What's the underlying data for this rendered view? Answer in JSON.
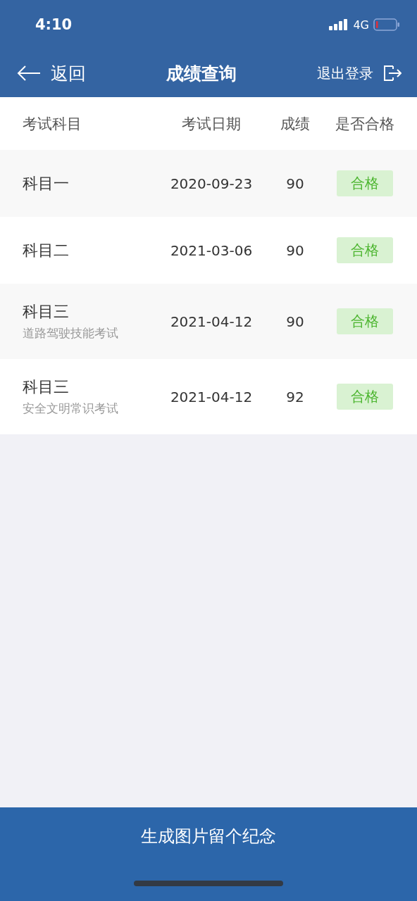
{
  "status_bar": {
    "time": "4:10",
    "network": "4G"
  },
  "nav": {
    "back": "返回",
    "title": "成绩查询",
    "logout": "退出登录"
  },
  "table": {
    "columns": [
      "考试科目",
      "考试日期",
      "成绩",
      "是否合格"
    ],
    "rows": [
      {
        "subject": "科目一",
        "date": "2020-09-23",
        "score": "90",
        "result": "合格",
        "passed": true
      },
      {
        "subject": "科目二",
        "date": "2021-03-06",
        "score": "90",
        "result": "合格",
        "passed": true
      },
      {
        "subject": "科目三",
        "detail": "道路驾驶技能考试",
        "date": "2021-04-12",
        "score": "90",
        "result": "合格",
        "passed": true
      },
      {
        "subject": "科目三",
        "detail": "安全文明常识考试",
        "date": "2021-04-12",
        "score": "92",
        "result": "合格",
        "passed": true
      }
    ]
  },
  "bottom_button": "生成图片留个纪念"
}
